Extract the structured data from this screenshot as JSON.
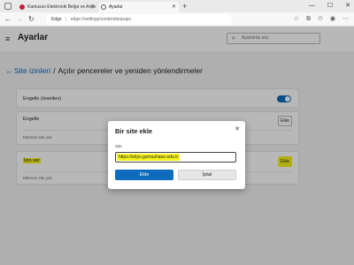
{
  "browser": {
    "tabs": [
      {
        "title": "Kamusso Elektronik Belge ve Arşiv",
        "active": false,
        "favicon_color": "#c41e3a"
      },
      {
        "title": "Ayarlar",
        "active": true
      }
    ],
    "window_controls": {
      "minimize": "—",
      "maximize": "☐",
      "close": "✕"
    },
    "address": {
      "site_label": "Edge",
      "separator": "|",
      "url": "edge://settings/content/popups"
    }
  },
  "header": {
    "title": "Ayarlar",
    "search_placeholder": "Ayarlarda ara"
  },
  "breadcrumb": {
    "back": "←",
    "link": "Site izinleri",
    "separator": "/",
    "current": "Açılır pencereler ve yeniden yönlendirmeler"
  },
  "cards": {
    "blocked_recommended": {
      "label": "Engelle (önerilen)",
      "toggle_on": true
    },
    "block": {
      "label": "Engelle",
      "button": "Ekle",
      "empty": "Eklenen site yok"
    },
    "allow": {
      "label": "İzin ver",
      "button": "Ekle",
      "empty": "Eklenen site yok"
    }
  },
  "dialog": {
    "title": "Bir site ekle",
    "close": "✕",
    "field_label": "Site",
    "field_value": "https://ebys.gumushane.edu.tr",
    "primary_button": "Ekle",
    "secondary_button": "İptal"
  },
  "colors": {
    "accent": "#0f6cbd",
    "highlight": "#f7f31c"
  }
}
